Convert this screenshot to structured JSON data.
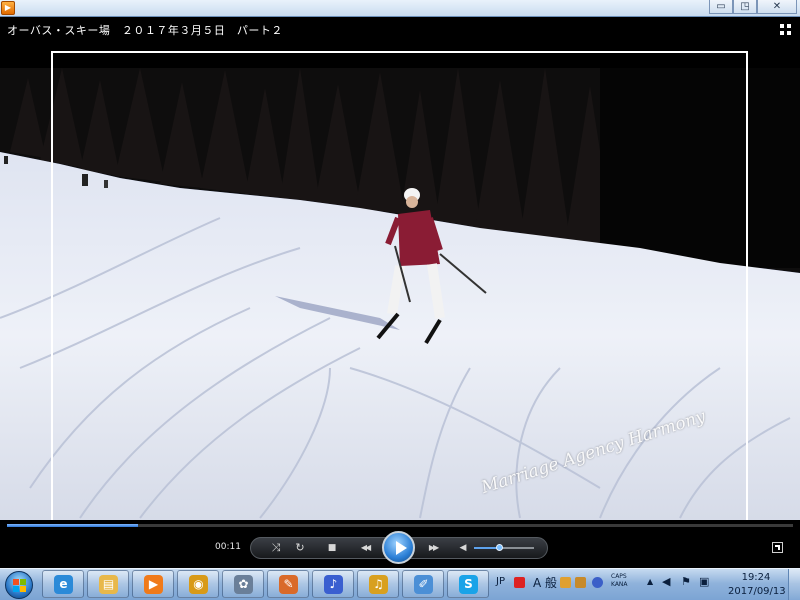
{
  "window": {
    "app_icon": "wmp-app-icon",
    "minimize_icon": "▭",
    "maximize_icon": "◳",
    "close_icon": "✕"
  },
  "player": {
    "title": "オーバス・スキー場　２０１７年３月５日　パート２",
    "time": "00:11",
    "seek_progress": 0.167,
    "volume_level": 0.42,
    "watermark": "Marriage Agency Harmony",
    "controls": {
      "shuffle_icon": "⤨",
      "repeat_icon": "↻",
      "stop_icon": "■",
      "previous_icon": "◀◀",
      "next_icon": "▶▶",
      "mute_icon": "◀"
    }
  },
  "taskbar": {
    "pinned": [
      {
        "name": "internet-explorer",
        "glyph": "e",
        "color": "#2b8ad8"
      },
      {
        "name": "file-explorer",
        "glyph": "▤",
        "color": "#e8b84a"
      },
      {
        "name": "windows-media-player",
        "glyph": "▶",
        "color": "#f07a1a"
      },
      {
        "name": "media-app",
        "glyph": "◉",
        "color": "#d89a18"
      },
      {
        "name": "photo-app",
        "glyph": "✿",
        "color": "#6a7f99"
      },
      {
        "name": "image-editor",
        "glyph": "✎",
        "color": "#d96a2a"
      },
      {
        "name": "music-app",
        "glyph": "♪",
        "color": "#3a5fd0"
      },
      {
        "name": "audio-app",
        "glyph": "♫",
        "color": "#d8a020"
      },
      {
        "name": "paint-app",
        "glyph": "✐",
        "color": "#4b8fd6"
      },
      {
        "name": "skype",
        "glyph": "S",
        "color": "#1aa3e8"
      }
    ],
    "tray": {
      "ime_lang": "JP",
      "ime_mode": "A 般",
      "caps": "CAPS",
      "kana": "KANA",
      "time": "19:24",
      "date": "2017/09/13"
    }
  }
}
